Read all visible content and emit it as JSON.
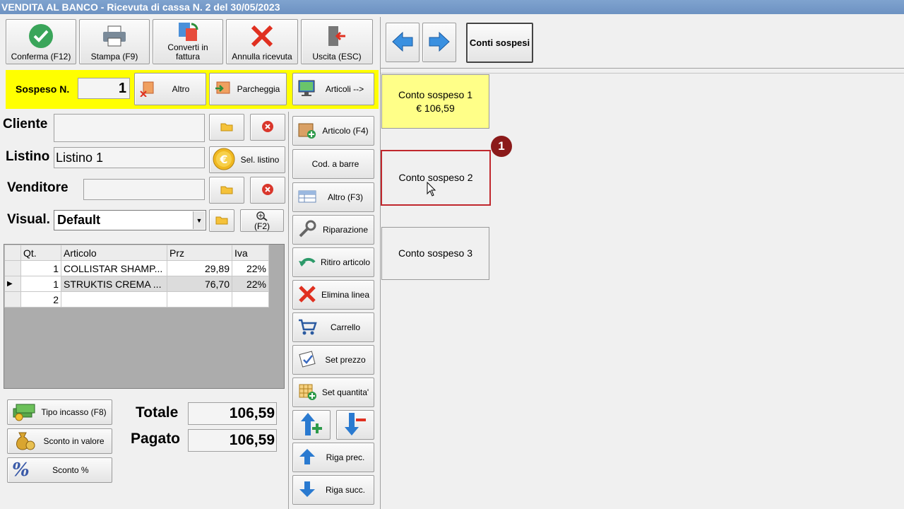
{
  "window": {
    "title": "VENDITA AL BANCO - Ricevuta di cassa N. 2 del 30/05/2023"
  },
  "toolbar": {
    "confirm": "Conferma (F12)",
    "print": "Stampa (F9)",
    "convert_line1": "Converti in",
    "convert_line2": "fattura",
    "cancel": "Annulla ricevuta",
    "exit": "Uscita (ESC)"
  },
  "suspended": {
    "label": "Sospeso N.",
    "number": "1",
    "other": "Altro",
    "park": "Parcheggia",
    "articles": "Articoli -->"
  },
  "form": {
    "customer_label": "Cliente",
    "customer_value": "",
    "pricelist_label": "Listino",
    "pricelist_value": "Listino 1",
    "select_pricelist": "Sel. listino",
    "seller_label": "Venditore",
    "seller_value": "",
    "view_label": "Visual.",
    "view_value": "Default",
    "zoom_key": "(F2)"
  },
  "items_table": {
    "headers": {
      "qty": "Qt.",
      "article": "Articolo",
      "price": "Prz",
      "vat": "Iva"
    },
    "rows": [
      {
        "qty": "1",
        "article": "COLLISTAR SHAMP...",
        "price": "29,89",
        "vat": "22%"
      },
      {
        "qty": "1",
        "article": "STRUKTIS CREMA ...",
        "price": "76,70",
        "vat": "22%"
      },
      {
        "qty": "2",
        "article": "",
        "price": "",
        "vat": ""
      }
    ]
  },
  "actions": {
    "article": "Articolo (F4)",
    "barcode": "Cod. a barre",
    "other": "Altro (F3)",
    "repair": "Riparazione",
    "withdraw": "Ritiro articolo",
    "delete_line": "Elimina linea",
    "cart": "Carrello",
    "set_price": "Set prezzo",
    "set_qty": "Set quantita'",
    "prev_row": "Riga prec.",
    "next_row": "Riga succ."
  },
  "payment": {
    "type": "Tipo incasso (F8)",
    "discount_value": "Sconto in valore",
    "discount_pct": "Sconto %"
  },
  "totals": {
    "total_label": "Totale",
    "total_value": "106,59",
    "paid_label": "Pagato",
    "paid_value": "106,59"
  },
  "right_panel": {
    "suspended_accounts": "Conti sospesi",
    "accounts": [
      {
        "name": "Conto sospeso 1",
        "amount": "€ 106,59"
      },
      {
        "name": "Conto sospeso 2",
        "amount": ""
      },
      {
        "name": "Conto sospeso 3",
        "amount": ""
      }
    ],
    "callout": "1"
  },
  "colors": {
    "title_bar": "#7fa3cf",
    "highlight_yellow": "#ffff00",
    "card1_yellow": "#ffff88",
    "callout_red": "#8b1a1a"
  }
}
